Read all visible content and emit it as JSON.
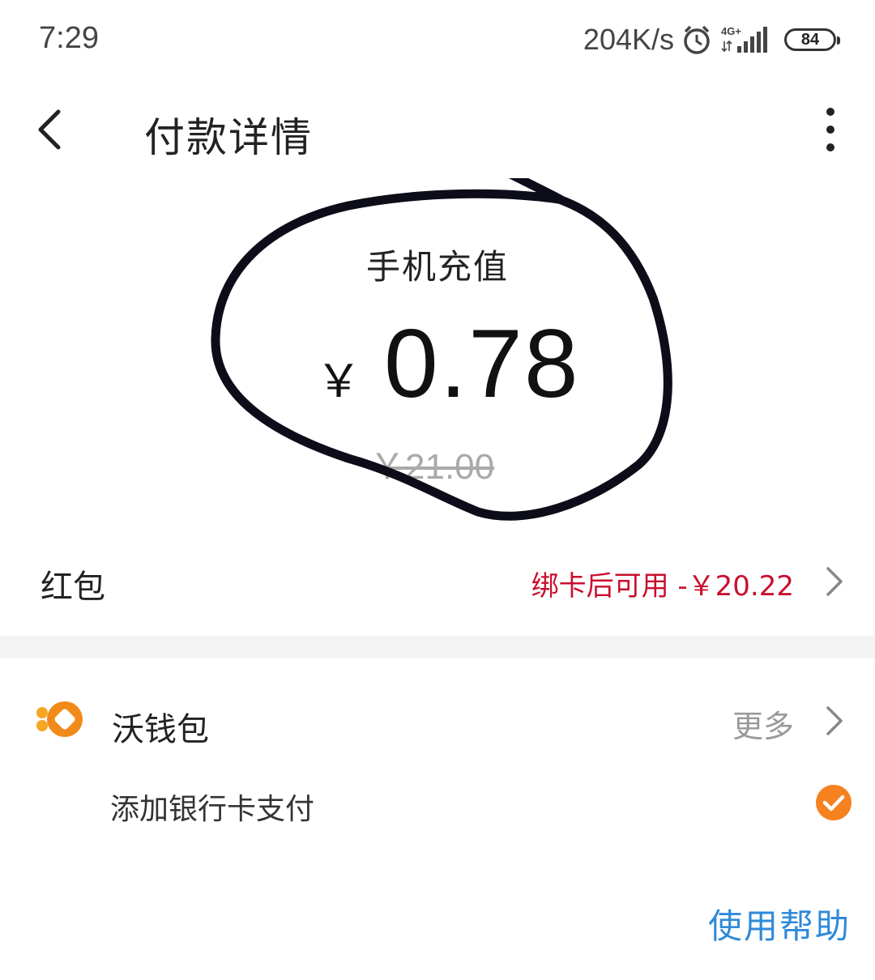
{
  "status_bar": {
    "time": "7:29",
    "net_speed": "204K/s",
    "network_type": "4G+",
    "battery": "84"
  },
  "header": {
    "title": "付款详情",
    "back_icon": "chevron-left-icon",
    "more_icon": "more-vertical-icon"
  },
  "payment": {
    "product": "手机充值",
    "currency": "￥",
    "amount": "0.78",
    "original_price": "￥21.00"
  },
  "red_packet": {
    "label": "红包",
    "value": "绑卡后可用 -￥20.22"
  },
  "wallet": {
    "name": "沃钱包",
    "more": "更多",
    "logo_color": "#f28a1a"
  },
  "bank_card": {
    "label": "添加银行卡支付",
    "selected": true,
    "check_color": "#f5811f"
  },
  "help": {
    "label": "使用帮助"
  },
  "colors": {
    "accent_red": "#c8102e",
    "link_blue": "#2f8ad8"
  }
}
